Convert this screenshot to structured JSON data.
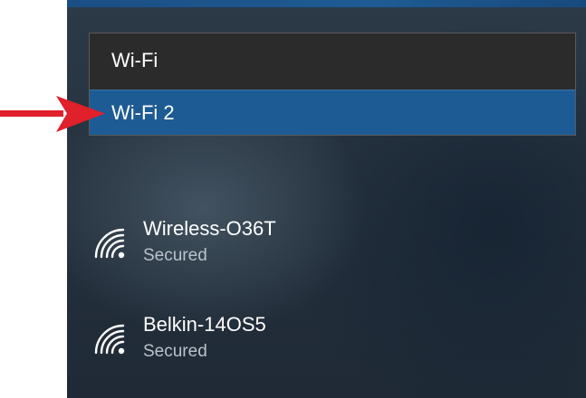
{
  "dropdown": {
    "options": [
      {
        "label": "Wi-Fi",
        "selected": false
      },
      {
        "label": "Wi-Fi 2",
        "selected": true
      }
    ]
  },
  "networks": [
    {
      "name": "Wireless-O36T",
      "status": "Secured",
      "icon": "wifi-signal-icon"
    },
    {
      "name": "Belkin-14OS5",
      "status": "Secured",
      "icon": "wifi-signal-icon"
    }
  ],
  "annotation": {
    "icon": "red-arrow-icon",
    "color": "#e0202a"
  },
  "colors": {
    "selected_option": "#1d5b95",
    "dropdown_bg": "#2b2b2b",
    "panel_bg": "#26323f"
  }
}
